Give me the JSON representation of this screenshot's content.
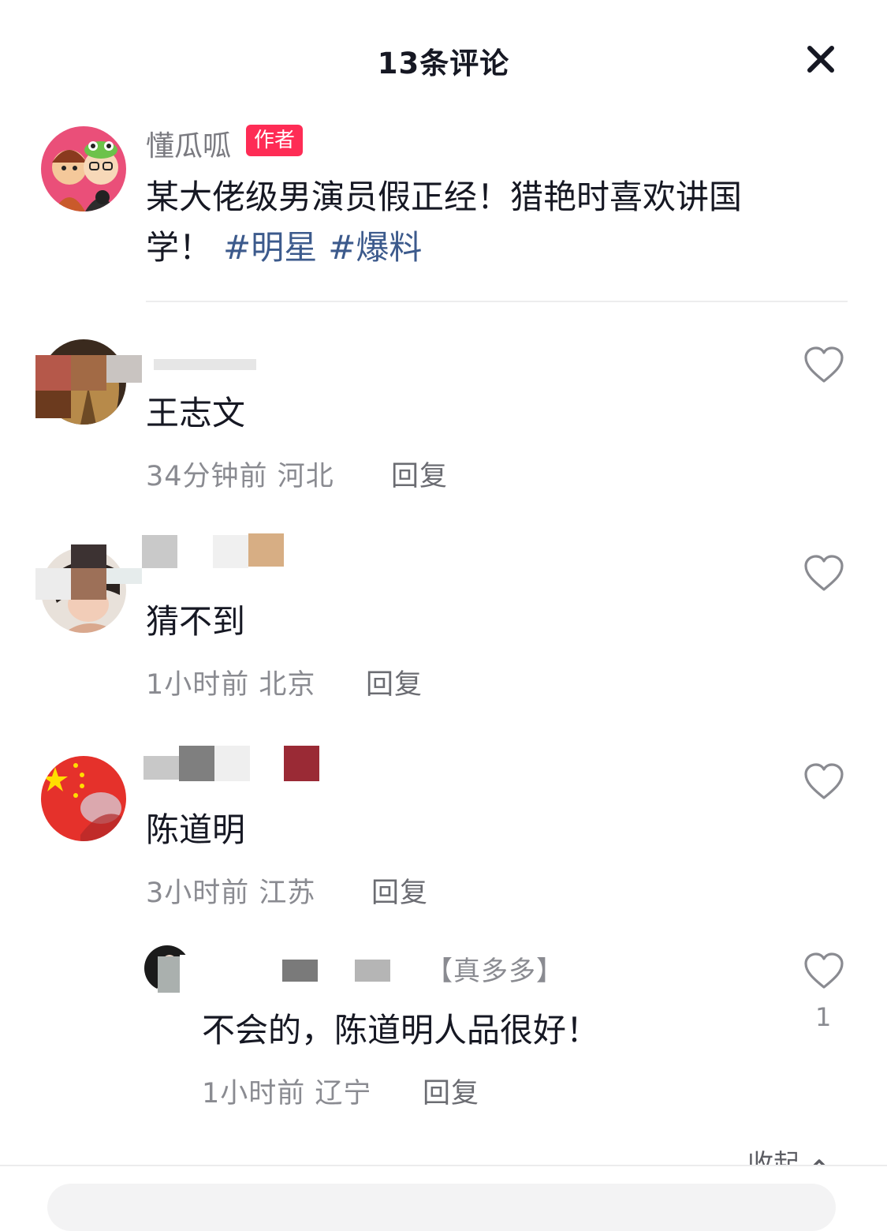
{
  "header": {
    "title": "13条评论",
    "close_icon": "close-icon"
  },
  "post": {
    "author_name": "懂瓜呱",
    "author_badge": "作者",
    "text": "某大佬级男演员假正经！猎艳时喜欢讲国学！",
    "tags": [
      "#明星",
      "#爆料"
    ]
  },
  "comments": [
    {
      "text": "王志文",
      "time": "34分钟前",
      "location": "河北",
      "reply_label": "回复"
    },
    {
      "text": "猜不到",
      "time": "1小时前",
      "location": "北京",
      "reply_label": "回复"
    },
    {
      "text": "陈道明",
      "time": "3小时前",
      "location": "江苏",
      "reply_label": "回复",
      "replies": [
        {
          "name_visible": "【真多多】",
          "text": "不会的，陈道明人品很好！",
          "time": "1小时前",
          "location": "辽宁",
          "reply_label": "回复",
          "likes": "1"
        }
      ]
    }
  ],
  "footer": {
    "collapse_label": "收起"
  },
  "colors": {
    "author_badge": "#fe2c55",
    "tag": "#3c5a8c",
    "meta": "#8a8b91"
  }
}
